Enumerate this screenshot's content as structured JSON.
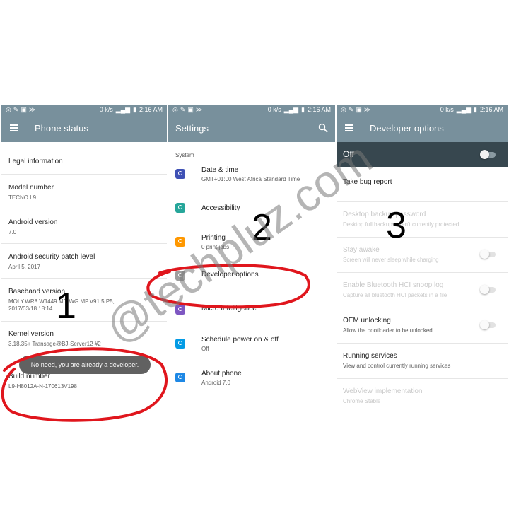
{
  "status_bar": {
    "left_icons": [
      "shield-icon",
      "wrench-icon",
      "image-icon",
      "vpn-icon"
    ],
    "speed": "0 k/s",
    "time": "2:16 AM"
  },
  "panel1": {
    "title": "Phone status",
    "rows": [
      {
        "title": "Legal information",
        "sub": ""
      },
      {
        "title": "Model number",
        "sub": "TECNO L9"
      },
      {
        "title": "Android version",
        "sub": "7.0"
      },
      {
        "title": "Android security patch level",
        "sub": "April 5, 2017"
      },
      {
        "title": "Baseband version",
        "sub": "MOLY.WR8.W1449.MD.WG.MP.V91.5.P5, 2017/03/18 18:14"
      },
      {
        "title": "Kernel version",
        "sub": "3.18.35+ Transage@BJ-Server12 #2"
      },
      {
        "title": "Build number",
        "sub": "L9-H8012A-N-170613V198"
      }
    ],
    "toast": "No need, you are already a developer."
  },
  "panel2": {
    "title": "Settings",
    "section": "System",
    "items": [
      {
        "title": "Date & time",
        "sub": "GMT+01:00 West Africa Standard Time",
        "icon": "clock-icon",
        "color": "#3f51b5"
      },
      {
        "title": "Accessibility",
        "sub": "",
        "icon": "accessibility-icon",
        "color": "#26a69a"
      },
      {
        "title": "Printing",
        "sub": "0 print jobs",
        "icon": "printer-icon",
        "color": "#ff9800"
      },
      {
        "title": "Developer options",
        "sub": "",
        "icon": "braces-icon",
        "color": "#9e9e9e"
      },
      {
        "title": "Micro Intelligence",
        "sub": "",
        "icon": "micro-intelligence-icon",
        "color": "#7e57c2"
      },
      {
        "title": "Schedule power on & off",
        "sub": "Off",
        "icon": "power-icon",
        "color": "#039be5"
      },
      {
        "title": "About phone",
        "sub": "Android 7.0",
        "icon": "phone-icon",
        "color": "#1e88e5"
      }
    ]
  },
  "panel3": {
    "title": "Developer options",
    "master": {
      "label": "Off",
      "on": false
    },
    "rows": [
      {
        "title": "Take bug report",
        "sub": "",
        "enabled": true,
        "toggle": false
      },
      {
        "title": "Desktop backup password",
        "sub": "Desktop full backups aren't currently protected",
        "enabled": false,
        "toggle": false
      },
      {
        "title": "Stay awake",
        "sub": "Screen will never sleep while charging",
        "enabled": false,
        "toggle": true
      },
      {
        "title": "Enable Bluetooth HCI snoop log",
        "sub": "Capture all bluetooth HCI packets in a file",
        "enabled": false,
        "toggle": true
      },
      {
        "title": "OEM unlocking",
        "sub": "Allow the bootloader to be unlocked",
        "enabled": true,
        "toggle": true
      },
      {
        "title": "Running services",
        "sub": "View and control currently running services",
        "enabled": true,
        "toggle": false
      },
      {
        "title": "WebView implementation",
        "sub": "Chrome Stable",
        "enabled": false,
        "toggle": false
      }
    ]
  },
  "overlay": {
    "step1": "1",
    "step2": "2",
    "step3": "3",
    "watermark": "@techpluz.com",
    "annotation_color": "#e0161d"
  }
}
